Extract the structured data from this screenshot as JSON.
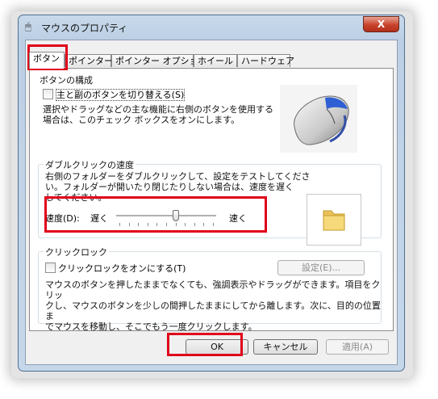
{
  "window": {
    "title": "マウスのプロパティ",
    "close_label": "X"
  },
  "tabs": [
    {
      "label": "ボタン"
    },
    {
      "label": "ポインター"
    },
    {
      "label": "ポインター オプション"
    },
    {
      "label": "ホイール"
    },
    {
      "label": "ハードウェア"
    }
  ],
  "button_config": {
    "group_label": "ボタンの構成",
    "swap_checkbox_label": "主と副のボタンを切り替える(S)",
    "swap_checked": false,
    "description_line1": "選択やドラッグなどの主な機能に右側のボタンを使用する",
    "description_line2": "場合は、このチェック ボックスをオンにします。"
  },
  "double_click": {
    "group_label": "ダブルクリックの速度",
    "description_line1": "右側のフォルダーをダブルクリックして、設定をテストしてくださ",
    "description_line2": "い。フォルダーが開いたり閉じたりしない場合は、速度を遅く",
    "description_line3": "してください。",
    "speed_label": "速度(D):",
    "slow_label": "遅く",
    "fast_label": "速く",
    "speed_value": 0.6
  },
  "click_lock": {
    "group_label": "クリックロック",
    "checkbox_label": "クリックロックをオンにする(T)",
    "checked": false,
    "settings_button": "設定(E)...",
    "description_line1": "マウスのボタンを押したままでなくても、強調表示やドラッグができます。項目をクリッ",
    "description_line2": "クし、マウスのボタンを少しの間押したままにしてから離します。次に、目的の位置ま",
    "description_line3": "でマウスを移動し、そこでもう一度クリックします。"
  },
  "footer": {
    "ok": "OK",
    "cancel": "キャンセル",
    "apply": "適用(A)"
  },
  "colors": {
    "highlight": "#e0001b",
    "title_bar": "#bccfe4",
    "close_button": "#c8432c"
  }
}
